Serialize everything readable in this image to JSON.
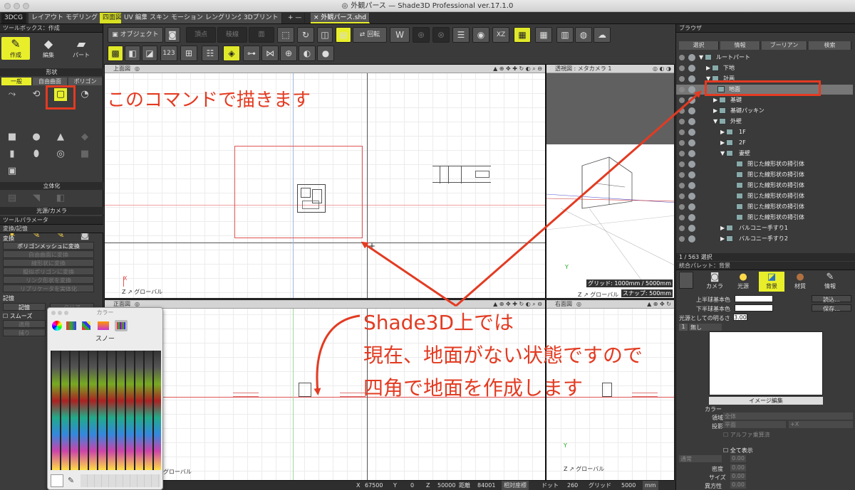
{
  "window": {
    "title": "外観パース — Shade3D Professional ver.17.1.0"
  },
  "tabs": [
    {
      "label": "3DCG"
    },
    {
      "label": "レイアウト"
    },
    {
      "label": "モデリング"
    },
    {
      "label": "四面図"
    },
    {
      "label": "UV 編集"
    },
    {
      "label": "スキン"
    },
    {
      "label": "モーション"
    },
    {
      "label": "レングリング"
    },
    {
      "label": "3Dプリント"
    },
    {
      "label": "+ —"
    },
    {
      "label": "× 外観パース.shd"
    }
  ],
  "toolbox": {
    "header": "ツールボックス：作成",
    "modes": {
      "create": "作成",
      "edit": "編集",
      "part": "パート"
    },
    "shape_section": "形状",
    "shape_tabs": {
      "general": "一般",
      "freeform": "自由曲面",
      "polygon": "ポリゴン"
    },
    "solidify_section": "立体化",
    "light_section": "光源/カメラ"
  },
  "tool_params": {
    "header": "ツールパラメータ",
    "subheader": "変換/記憶",
    "convert_label": "変換",
    "buttons": [
      "ポリゴンメッシュに変換",
      "自由曲面に変換",
      "線形状に変換",
      "擬似ポリゴンに変換",
      "リンク形状を変換",
      "リプリケータを実体化"
    ],
    "memory_label": "記憶",
    "memory_btn": "記憶",
    "clear_btn": "クリア",
    "smooth_label": "スムーズ",
    "apply_btn": "適用",
    "capture_btn": "捕り"
  },
  "toolbar": {
    "object_btn": "オブジェクト",
    "vertex_btn": "頂点",
    "edge_btn": "稜線",
    "face_btn": "面",
    "rotate_btn": "回転",
    "xz_btn": "XZ"
  },
  "viewports": {
    "top": {
      "label": "上面図",
      "axis_label": "グローバル"
    },
    "perspective": {
      "label": "透視図 : メタカメラ 1",
      "grid": "グリッド: 1000mm / 5000mm",
      "snap": "スナップ: 500mm",
      "axis_label": "グローバル"
    },
    "front": {
      "label": "正面図",
      "axis_label": "グローバル"
    },
    "right": {
      "label": "右面図",
      "axis_label": "グローバル"
    }
  },
  "browser": {
    "header": "ブラウザ",
    "tabs": [
      "選択",
      "情報",
      "ブーリアン",
      "検索"
    ],
    "tree": [
      {
        "label": "ルートパート",
        "depth": 0
      },
      {
        "label": "下地",
        "depth": 1
      },
      {
        "label": "計画",
        "depth": 1
      },
      {
        "label": "地面",
        "depth": 2
      },
      {
        "label": "基礎",
        "depth": 2
      },
      {
        "label": "基礎パッキン",
        "depth": 2
      },
      {
        "label": "外壁",
        "depth": 2
      },
      {
        "label": "1F",
        "depth": 3
      },
      {
        "label": "2F",
        "depth": 3
      },
      {
        "label": "妻壁",
        "depth": 3
      },
      {
        "label": "閉じた線形状の掃引体",
        "depth": 4
      },
      {
        "label": "閉じた線形状の掃引体",
        "depth": 4
      },
      {
        "label": "閉じた線形状の掃引体",
        "depth": 4
      },
      {
        "label": "閉じた線形状の掃引体",
        "depth": 4
      },
      {
        "label": "閉じた線形状の掃引体",
        "depth": 4
      },
      {
        "label": "閉じた線形状の掃引体",
        "depth": 4
      },
      {
        "label": "バルコニー手すり1",
        "depth": 3
      },
      {
        "label": "バルコニー手すり2",
        "depth": 3
      }
    ],
    "selection_count": "1 / 563 選択"
  },
  "integrated_palette": {
    "header": "統合パレット：背景",
    "tabs": [
      "カメラ",
      "光源",
      "背景",
      "材質",
      "情報"
    ],
    "upper_color": "上半球基本色",
    "lower_color": "下半球基本色",
    "load_btn": "読込...",
    "save_btn": "保存...",
    "brightness_label": "光源としての明るさ",
    "brightness_value": "3.00",
    "layer_index": "1",
    "layer_none": "無し",
    "image_edit_btn": "イメージ編集",
    "color_label": "カラー",
    "region_label": "領域",
    "region_value": "全体",
    "projection_label": "投影",
    "projection_value": "平面",
    "projection_axis": "+X",
    "alpha_label": "アルファ乗算済",
    "show_all_label": "全て表示",
    "normal_label": "通常",
    "density_label": "密度",
    "size_label": "サイズ",
    "anisotropy_label": "異方性",
    "zero": "0.00"
  },
  "status": {
    "x_label": "X",
    "x_value": "67500",
    "y_label": "Y",
    "y_value": "0",
    "z_label": "Z",
    "z_value": "50000",
    "distance_label": "距離",
    "distance_value": "84001",
    "coord_mode": "相対座標",
    "dot_label": "ドット",
    "dot_value": "260",
    "grid_label": "グリッド",
    "grid_value": "5000",
    "unit": "mm"
  },
  "color_window": {
    "title": "カラー",
    "pencil_name": "スノー"
  },
  "annotations": {
    "command_note": "このコマンドで描きます",
    "line1": "Shade3D上では",
    "line2": "現在、地面がない状態ですので",
    "line3": "四角で地面を作成します"
  },
  "colors": {
    "annotation_red": "#e33b22",
    "highlight_yellow": "#e8ef2a"
  }
}
